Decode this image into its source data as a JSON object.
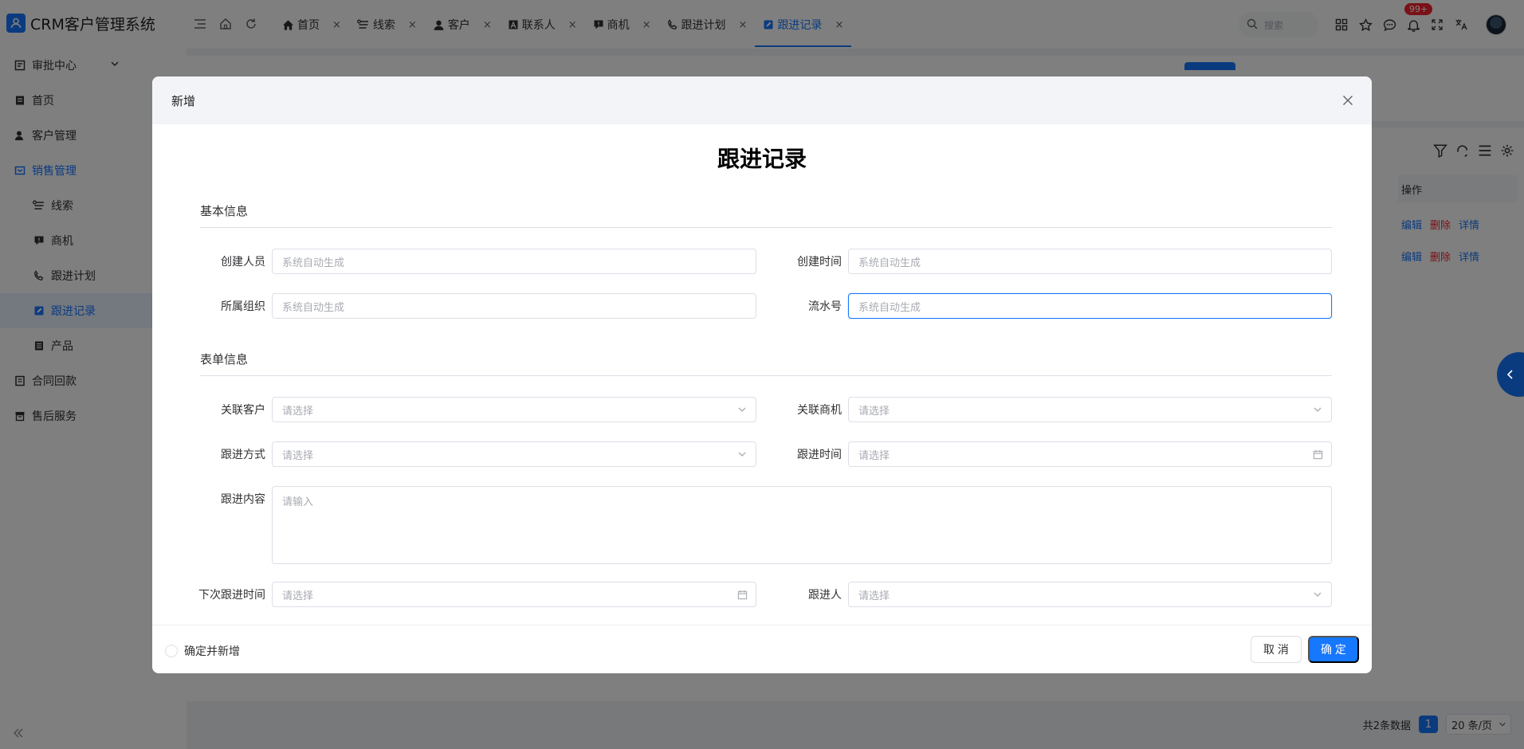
{
  "app": {
    "title": "CRM客户管理系统"
  },
  "sidebar": {
    "items": [
      {
        "label": "审批中心",
        "icon": "approval-icon"
      },
      {
        "label": "首页",
        "icon": "home-doc-icon"
      },
      {
        "label": "客户管理",
        "icon": "customer-icon"
      },
      {
        "label": "销售管理",
        "icon": "sales-icon"
      },
      {
        "label": "线索",
        "icon": "clue-icon"
      },
      {
        "label": "商机",
        "icon": "opportunity-icon"
      },
      {
        "label": "跟进计划",
        "icon": "phone-icon"
      },
      {
        "label": "跟进记录",
        "icon": "edit-icon"
      },
      {
        "label": "产品",
        "icon": "product-icon"
      },
      {
        "label": "合同回款",
        "icon": "contract-icon"
      },
      {
        "label": "售后服务",
        "icon": "service-icon"
      }
    ]
  },
  "tabs": [
    {
      "label": "首页",
      "close": "×"
    },
    {
      "label": "线索",
      "close": "×"
    },
    {
      "label": "客户",
      "close": "×"
    },
    {
      "label": "联系人",
      "close": "×"
    },
    {
      "label": "商机",
      "close": "×"
    },
    {
      "label": "跟进计划",
      "close": "×"
    },
    {
      "label": "跟进记录",
      "close": "×"
    }
  ],
  "header": {
    "search_placeholder": "搜索",
    "notification_count": "99+"
  },
  "list": {
    "ops_header": "操作",
    "ops": {
      "edit": "编辑",
      "delete": "删除",
      "detail": "详情"
    },
    "total": "共2条数据",
    "current_page": "1",
    "page_size": "20 条/页"
  },
  "dialog": {
    "header": "新增",
    "title": "跟进记录",
    "section_basic": "基本信息",
    "section_form": "表单信息",
    "fields": {
      "creator": {
        "label": "创建人员",
        "placeholder": "系统自动生成"
      },
      "created_at": {
        "label": "创建时间",
        "placeholder": "系统自动生成"
      },
      "org": {
        "label": "所属组织",
        "placeholder": "系统自动生成"
      },
      "serial_no": {
        "label": "流水号",
        "placeholder": "系统自动生成"
      },
      "customer": {
        "label": "关联客户",
        "placeholder": "请选择"
      },
      "opportunity": {
        "label": "关联商机",
        "placeholder": "请选择"
      },
      "method": {
        "label": "跟进方式",
        "placeholder": "请选择"
      },
      "follow_time": {
        "label": "跟进时间",
        "placeholder": "请选择"
      },
      "content": {
        "label": "跟进内容",
        "placeholder": "请输入"
      },
      "next_time": {
        "label": "下次跟进时间",
        "placeholder": "请选择"
      },
      "follower": {
        "label": "跟进人",
        "placeholder": "请选择"
      }
    },
    "confirm_and_new": "确定并新增",
    "cancel": "取 消",
    "ok": "确 定"
  },
  "colors": {
    "primary": "#1677ff",
    "danger": "#f5222d"
  }
}
